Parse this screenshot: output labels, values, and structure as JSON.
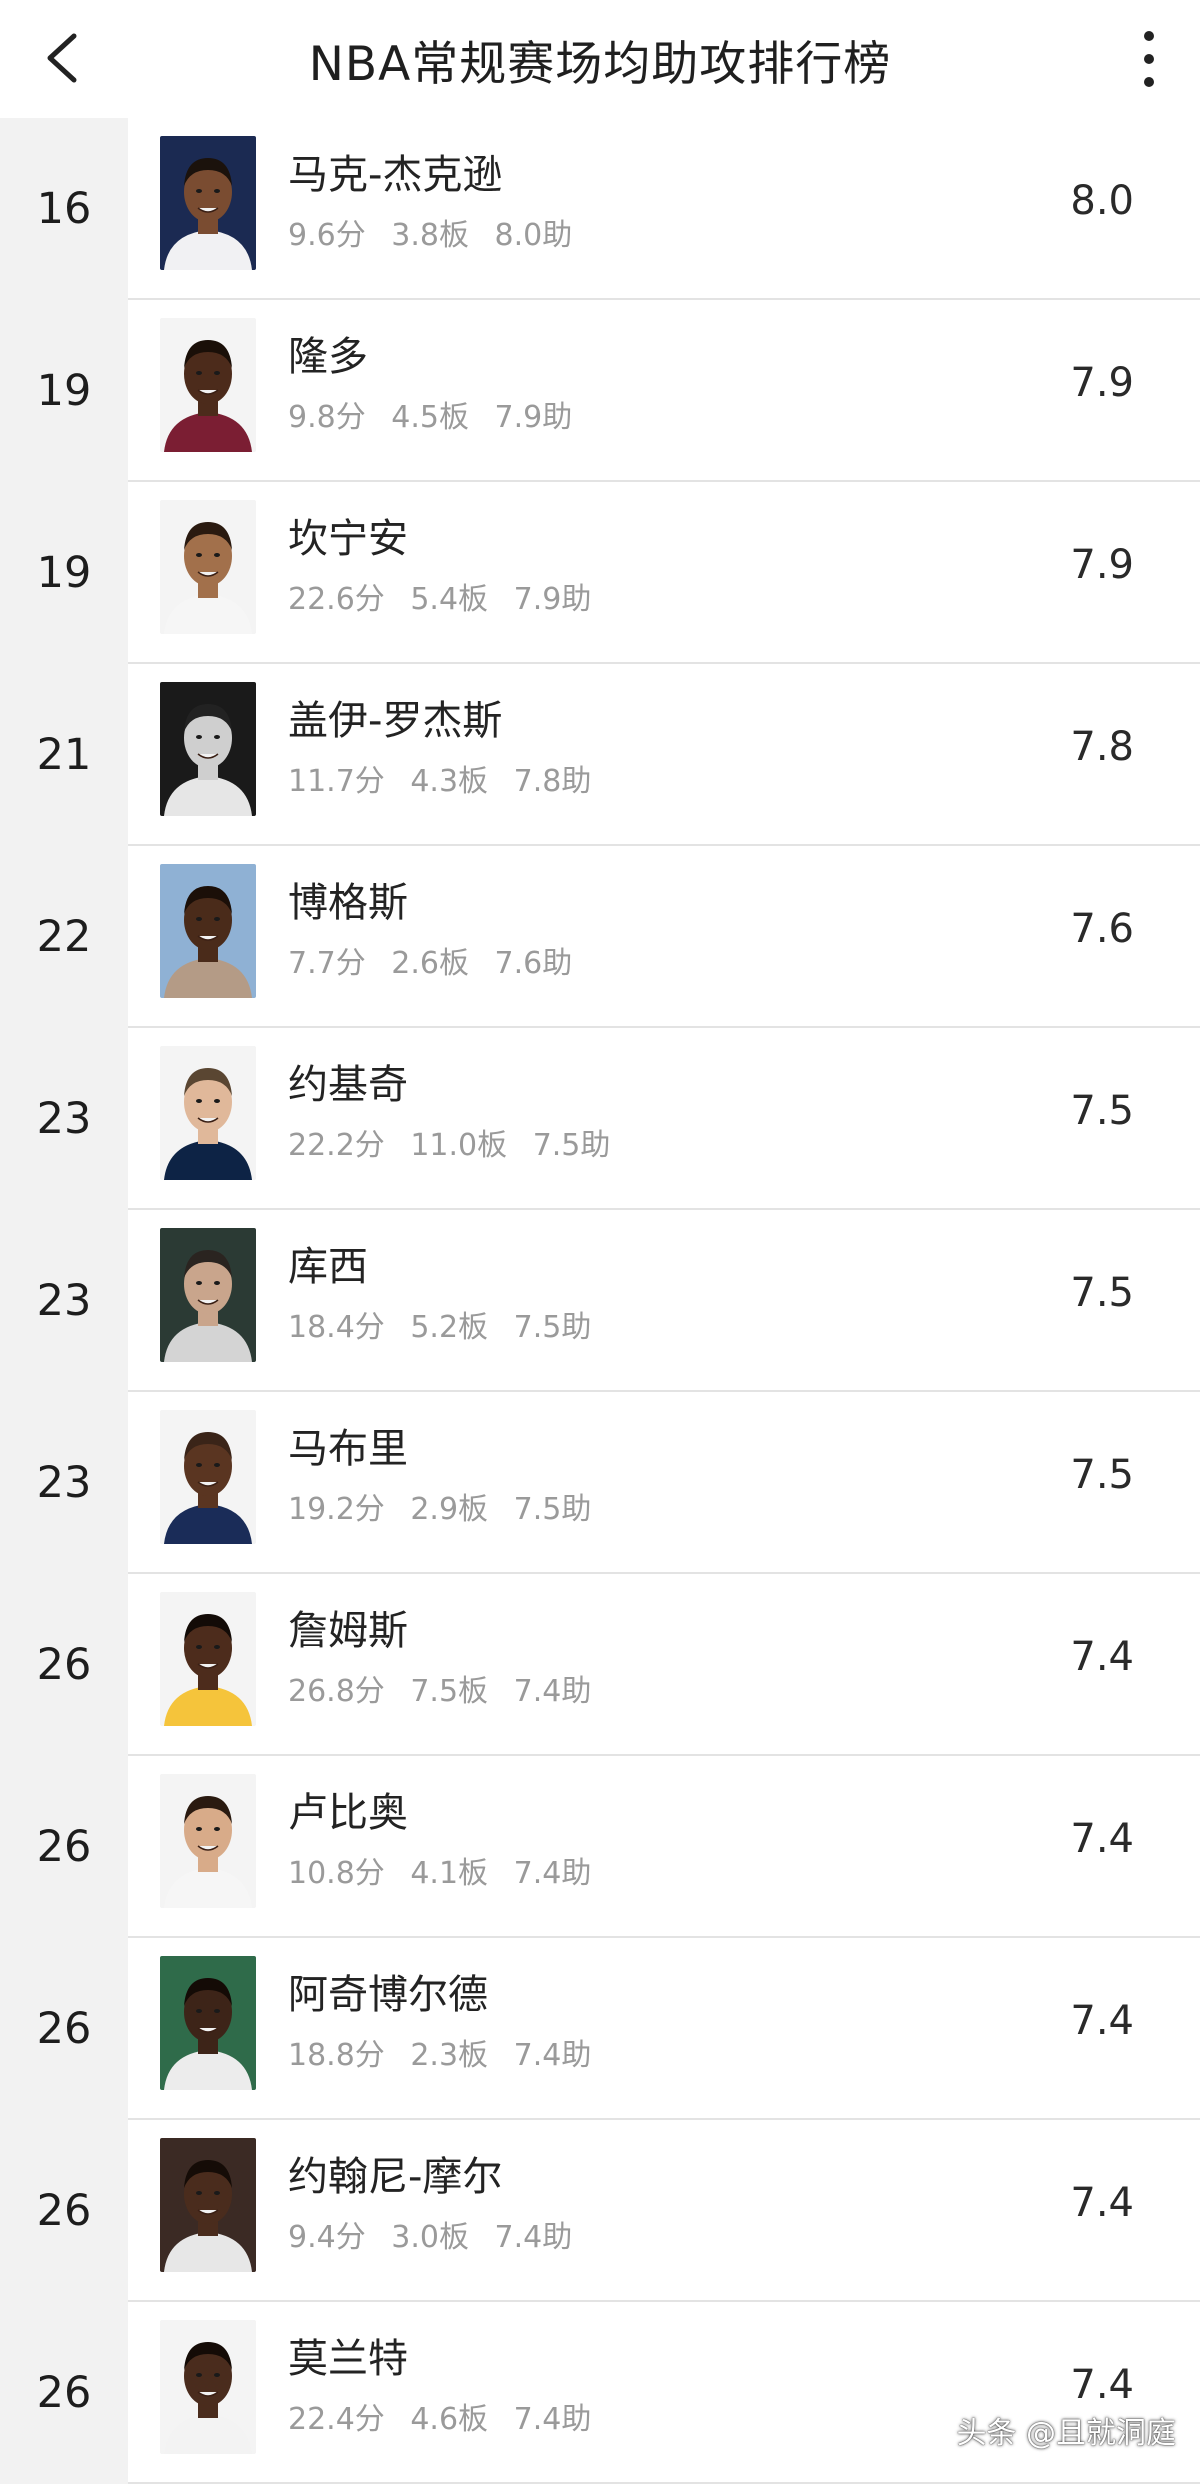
{
  "header": {
    "title": "NBA常规赛场均助攻排行榜",
    "back_icon": "chevron-left-icon",
    "more_icon": "vertical-dots-icon"
  },
  "players": [
    {
      "rank": "16",
      "name": "马克-杰克逊",
      "pts": "9.6分",
      "reb": "3.8板",
      "ast": "8.0助",
      "value": "8.0",
      "bg": "#1b2a52",
      "jersey": "#f1f1f3",
      "skin": "#7a4c31",
      "hair": "#1b120c"
    },
    {
      "rank": "19",
      "name": "隆多",
      "pts": "9.8分",
      "reb": "4.5板",
      "ast": "7.9助",
      "value": "7.9",
      "bg": "#f4f4f4",
      "jersey": "#7b1e33",
      "skin": "#4c2b1b",
      "hair": "#1a0f08"
    },
    {
      "rank": "19",
      "name": "坎宁安",
      "pts": "22.6分",
      "reb": "5.4板",
      "ast": "7.9助",
      "value": "7.9",
      "bg": "#f4f4f4",
      "jersey": "#f6f6f6",
      "skin": "#a2704b",
      "hair": "#2a1a10"
    },
    {
      "rank": "21",
      "name": "盖伊-罗杰斯",
      "pts": "11.7分",
      "reb": "4.3板",
      "ast": "7.8助",
      "value": "7.8",
      "bg": "#1a1a1a",
      "jersey": "#e6e6e6",
      "skin": "#cfcfcf",
      "hair": "#222"
    },
    {
      "rank": "22",
      "name": "博格斯",
      "pts": "7.7分",
      "reb": "2.6板",
      "ast": "7.6助",
      "value": "7.6",
      "bg": "#8fb1d4",
      "jersey": "#b49b86",
      "skin": "#4a2b1a",
      "hair": "#1b0f08"
    },
    {
      "rank": "23",
      "name": "约基奇",
      "pts": "22.2分",
      "reb": "11.0板",
      "ast": "7.5助",
      "value": "7.5",
      "bg": "#f4f4f4",
      "jersey": "#0d2345",
      "skin": "#e0b89a",
      "hair": "#5a4632"
    },
    {
      "rank": "23",
      "name": "库西",
      "pts": "18.4分",
      "reb": "5.2板",
      "ast": "7.5助",
      "value": "7.5",
      "bg": "#2b3a34",
      "jersey": "#d4d4d4",
      "skin": "#c9a58c",
      "hair": "#2a2420"
    },
    {
      "rank": "23",
      "name": "马布里",
      "pts": "19.2分",
      "reb": "2.9板",
      "ast": "7.5助",
      "value": "7.5",
      "bg": "#f4f4f4",
      "jersey": "#1a2c58",
      "skin": "#5a3521",
      "hair": "#3a2418"
    },
    {
      "rank": "26",
      "name": "詹姆斯",
      "pts": "26.8分",
      "reb": "7.5板",
      "ast": "7.4助",
      "value": "7.4",
      "bg": "#f4f4f4",
      "jersey": "#f5c43b",
      "skin": "#4d2c1c",
      "hair": "#130b07"
    },
    {
      "rank": "26",
      "name": "卢比奥",
      "pts": "10.8分",
      "reb": "4.1板",
      "ast": "7.4助",
      "value": "7.4",
      "bg": "#f4f4f4",
      "jersey": "#f6f6f6",
      "skin": "#d8ab89",
      "hair": "#2a1a10"
    },
    {
      "rank": "26",
      "name": "阿奇博尔德",
      "pts": "18.8分",
      "reb": "2.3板",
      "ast": "7.4助",
      "value": "7.4",
      "bg": "#2f6b4a",
      "jersey": "#ececec",
      "skin": "#3d2418",
      "hair": "#140b06"
    },
    {
      "rank": "26",
      "name": "约翰尼-摩尔",
      "pts": "9.4分",
      "reb": "3.0板",
      "ast": "7.4助",
      "value": "7.4",
      "bg": "#3b2a24",
      "jersey": "#e7e7e7",
      "skin": "#4a2c1d",
      "hair": "#150c07"
    },
    {
      "rank": "26",
      "name": "莫兰特",
      "pts": "22.4分",
      "reb": "4.6板",
      "ast": "7.4助",
      "value": "7.4",
      "bg": "#f4f4f4",
      "jersey": "#f3f3f3",
      "skin": "#4a2c1d",
      "hair": "#140b06"
    }
  ],
  "watermark": "头条 @且就洞庭"
}
